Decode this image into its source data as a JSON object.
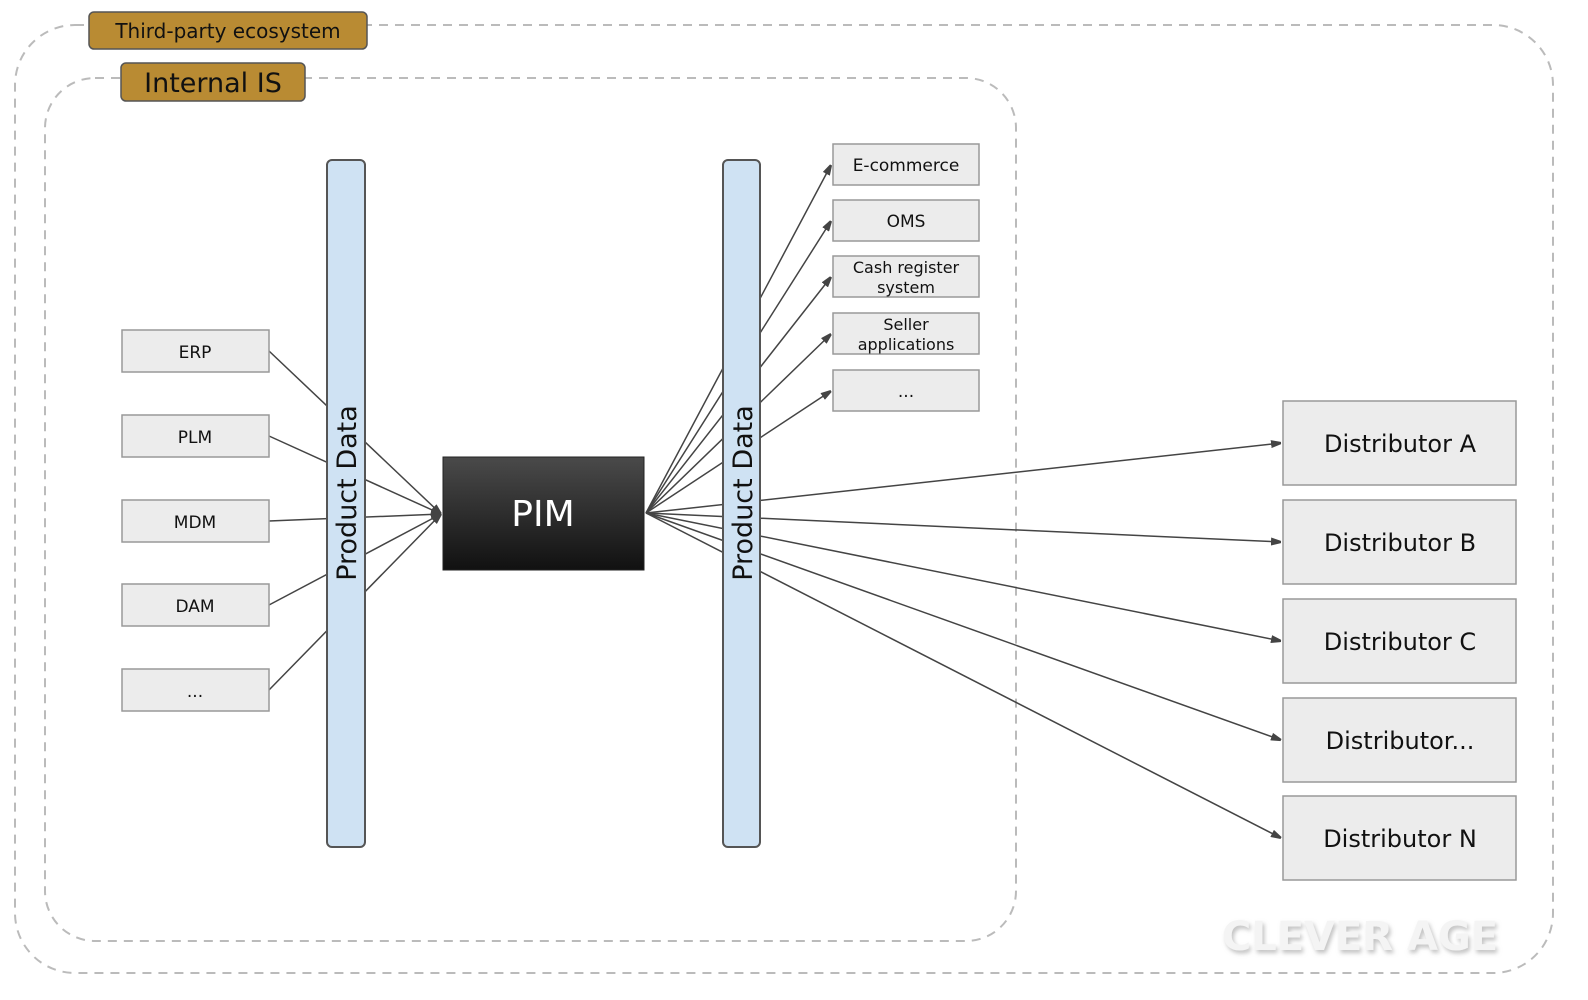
{
  "zones": {
    "third_party": "Third-party ecosystem",
    "internal": "Internal IS"
  },
  "colors": {
    "zone_label": "#b98b33",
    "bus": "#cfe2f3",
    "box": "#ececec",
    "pim": "#2a2a2a"
  },
  "sources": [
    "ERP",
    "PLM",
    "MDM",
    "DAM",
    "..."
  ],
  "bus_label": "Product Data",
  "pim": "PIM",
  "internal_targets": [
    [
      "E-commerce"
    ],
    [
      "OMS"
    ],
    [
      "Cash register",
      "system"
    ],
    [
      "Seller",
      "applications"
    ],
    [
      "..."
    ]
  ],
  "distributors": [
    "Distributor A",
    "Distributor B",
    "Distributor C",
    "Distributor...",
    "Distributor N"
  ],
  "watermark": "CLEVER AGE"
}
